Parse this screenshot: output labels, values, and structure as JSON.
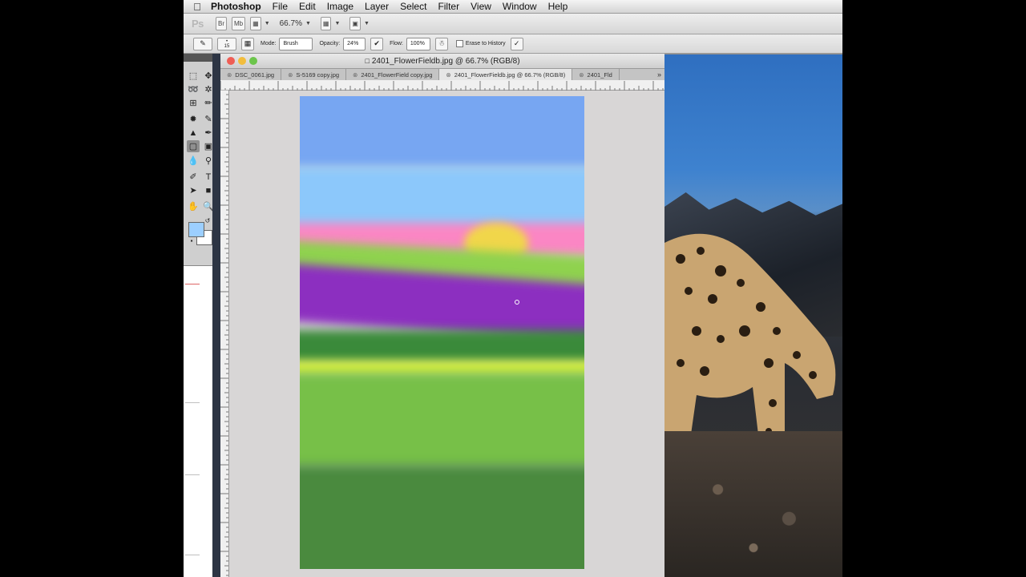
{
  "menubar": {
    "app_name": "Photoshop",
    "items": [
      "File",
      "Edit",
      "Image",
      "Layer",
      "Select",
      "Filter",
      "View",
      "Window",
      "Help"
    ]
  },
  "appbar": {
    "logo": "Ps",
    "bridge_label": "Br",
    "minibridge_label": "Mb",
    "zoom": "66.7%"
  },
  "options": {
    "brush_size": "15",
    "mode_label": "Mode:",
    "mode_value": "Brush",
    "opacity_label": "Opacity:",
    "opacity_value": "24%",
    "flow_label": "Flow:",
    "flow_value": "100%",
    "erase_history_label": "Erase to History"
  },
  "document": {
    "title": "2401_FlowerFieldb.jpg @ 66.7% (RGB/8)",
    "tabs": [
      {
        "label": "DSC_0061.jpg"
      },
      {
        "label": "S-5169 copy.jpg"
      },
      {
        "label": "2401_FlowerField copy.jpg"
      },
      {
        "label": "2401_FlowerFieldb.jpg @ 66.7% (RGB/8)"
      },
      {
        "label": "2401_Fld"
      }
    ],
    "active_tab": 3,
    "tab_overflow": "»"
  },
  "colors": {
    "foreground": "#9ccfff",
    "background": "#ffffff",
    "sky_top": "#77a6f2",
    "sky_light": "#8cc8fb",
    "pink": "#fb86c4",
    "sun": "#f1d64a",
    "light_green": "#8fd24e",
    "purple": "#8c2fc0",
    "dark_green": "#3a8a3a",
    "yellow_green": "#d4ee3a",
    "grass": "#77c048",
    "bottom_green": "#4a8a3e"
  },
  "icons": {
    "tools": [
      "marquee-icon",
      "move-icon",
      "lasso-icon",
      "quick-select-icon",
      "crop-icon",
      "eyedropper-icon",
      "healing-icon",
      "brush-icon",
      "stamp-icon",
      "history-brush-icon",
      "eraser-icon",
      "gradient-icon",
      "blur-icon",
      "dodge-icon",
      "pen-icon",
      "type-icon",
      "path-select-icon",
      "shape-icon",
      "hand-icon",
      "zoom-icon"
    ]
  }
}
